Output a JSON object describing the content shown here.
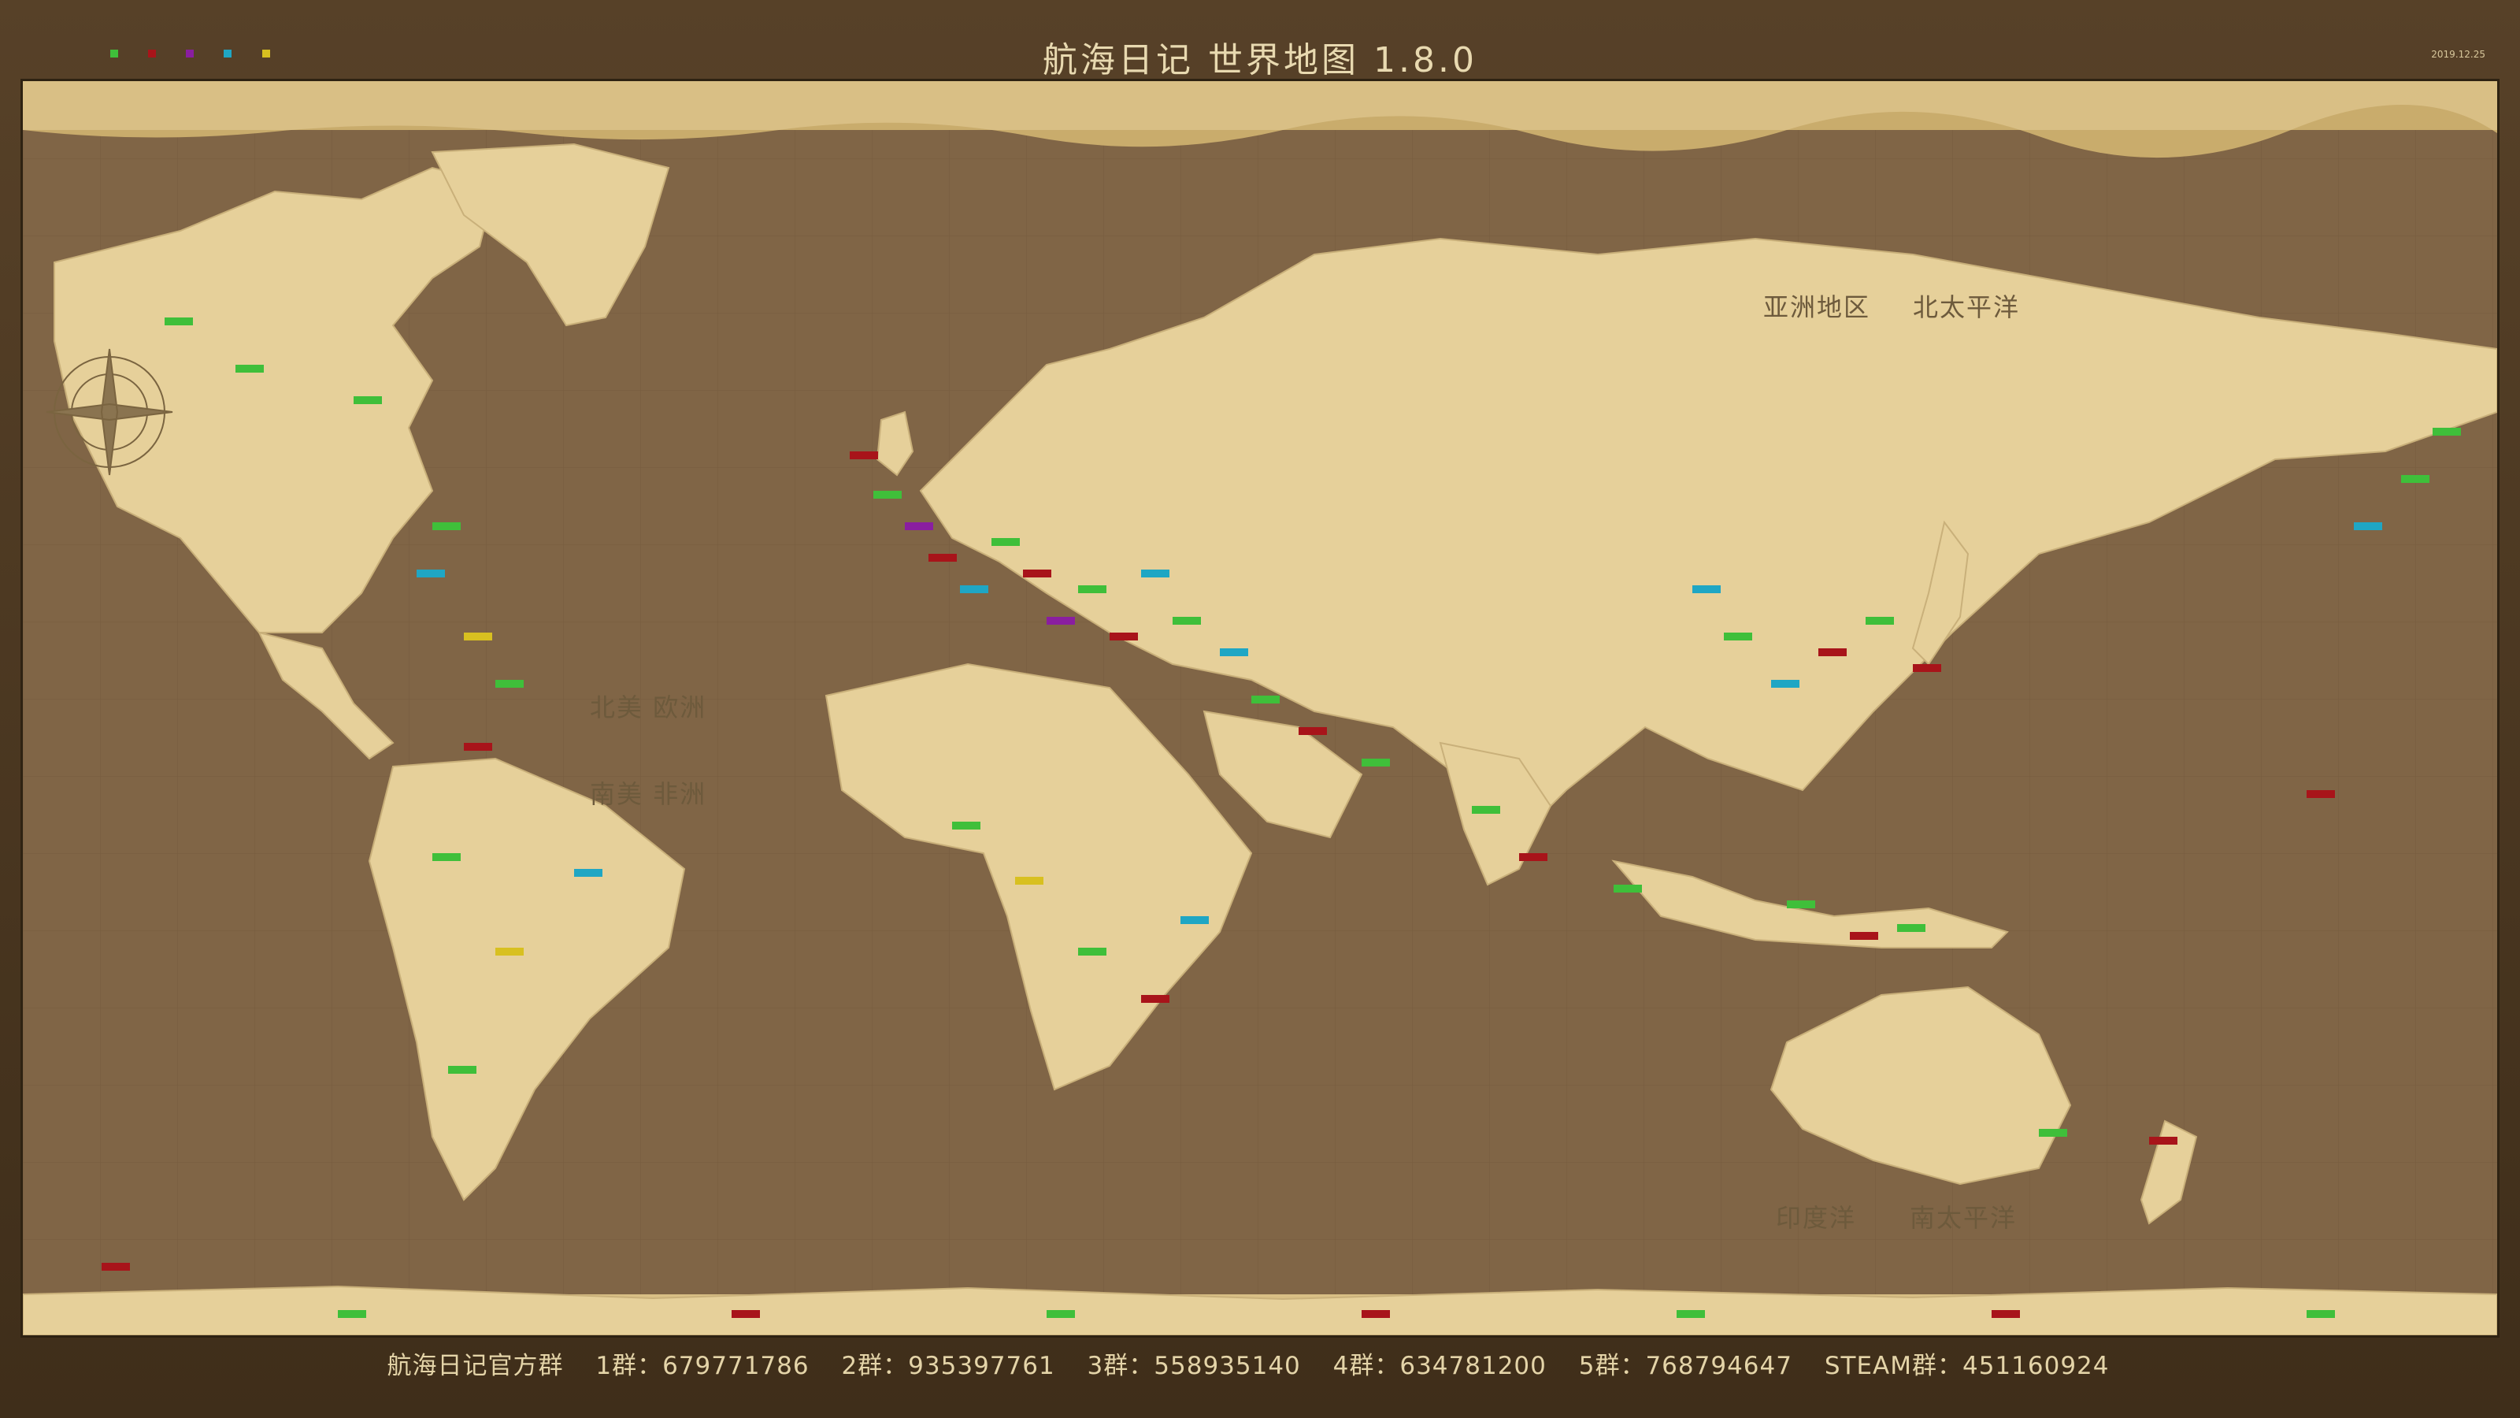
{
  "header": {
    "title": "航海日记 世界地图 1.8.0",
    "date": "2019.12.25"
  },
  "regions": {
    "north_america_europe": "北美 欧洲",
    "south_america_africa": "南美 非洲",
    "asia": "亚洲地区",
    "north_pacific": "北太平洋",
    "indian_ocean": "印度洋",
    "south_pacific": "南太平洋"
  },
  "footer": {
    "official": "航海日记官方群",
    "group1": "1群：679771786",
    "group2": "2群：935397761",
    "group3": "3群：558935140",
    "group4": "4群：634781200",
    "group5": "5群：768794647",
    "steam": "STEAM群：451160924"
  },
  "marker_colors": {
    "green": "#3fbf3a",
    "red": "#a8141a",
    "purple": "#8a1ea0",
    "cyan": "#1fa6c4",
    "yellow": "#d8c020"
  },
  "colors": {
    "ocean": "#806546",
    "land": "#e6d09a",
    "frame": "#4a3720"
  }
}
